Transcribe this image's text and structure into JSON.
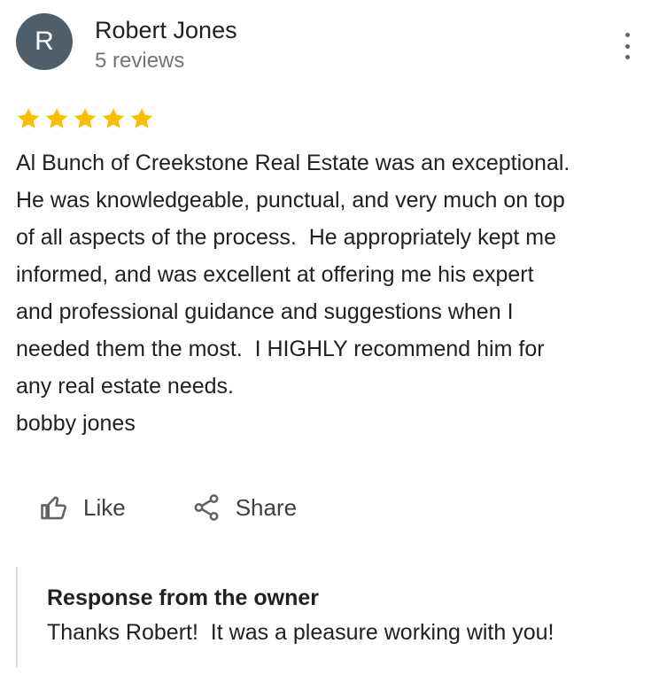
{
  "reviewer": {
    "avatar_letter": "R",
    "avatar_color": "#4e5f6b",
    "name": "Robert Jones",
    "review_count": "5 reviews"
  },
  "menu": {
    "icon": "more-vert-icon"
  },
  "rating": {
    "stars": 5,
    "max_stars": 5,
    "star_color": "#fbbc04"
  },
  "review": {
    "lines": [
      "Al Bunch of Creekstone Real Estate was an exceptional.",
      "He was knowledgeable, punctual, and very much on top",
      "of all aspects of the process.  He appropriately kept me",
      "informed, and was excellent at offering me his expert",
      "and professional guidance and suggestions when I",
      "needed them the most.  I HIGHLY recommend him for",
      "any real estate needs.",
      "bobby jones"
    ]
  },
  "actions": {
    "like_label": "Like",
    "like_icon": "thumb-up-icon",
    "share_label": "Share",
    "share_icon": "share-icon"
  },
  "owner_response": {
    "title": "Response from the owner",
    "text": "Thanks Robert!  It was a pleasure working with you!"
  }
}
